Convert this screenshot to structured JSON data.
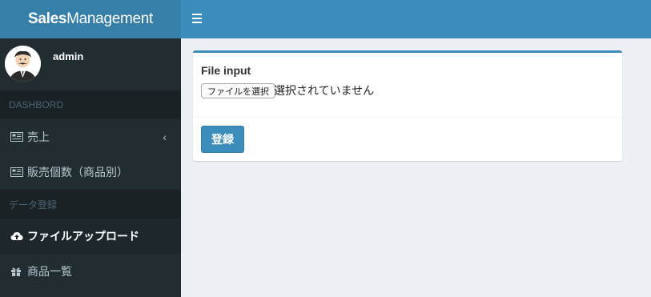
{
  "header": {
    "logo_bold": "Sales",
    "logo_rest": "Management",
    "menu_toggle_icon": "bars-icon"
  },
  "sidebar": {
    "user_name": "admin",
    "sections": [
      {
        "header": "DASHBORD",
        "items": [
          {
            "label": "売上",
            "icon": "newspaper-icon",
            "has_chevron": true,
            "chevron": "‹"
          },
          {
            "label": "販売個数（商品別）",
            "icon": "newspaper-icon"
          }
        ]
      },
      {
        "header": "データ登録",
        "items": [
          {
            "label": "ファイルアップロード",
            "icon": "cloud-upload-icon",
            "active": true
          },
          {
            "label": "商品一覧",
            "icon": "gift-icon"
          }
        ]
      }
    ]
  },
  "form": {
    "label": "File input",
    "file_button": "ファイルを選択",
    "file_status": "選択されていません",
    "submit": "登録"
  },
  "colors": {
    "header": "#3c8dbc",
    "logo_bg": "#367fa9",
    "sidebar": "#222d32",
    "sidebar_header": "#1a2226",
    "content_bg": "#ecf0f5"
  }
}
